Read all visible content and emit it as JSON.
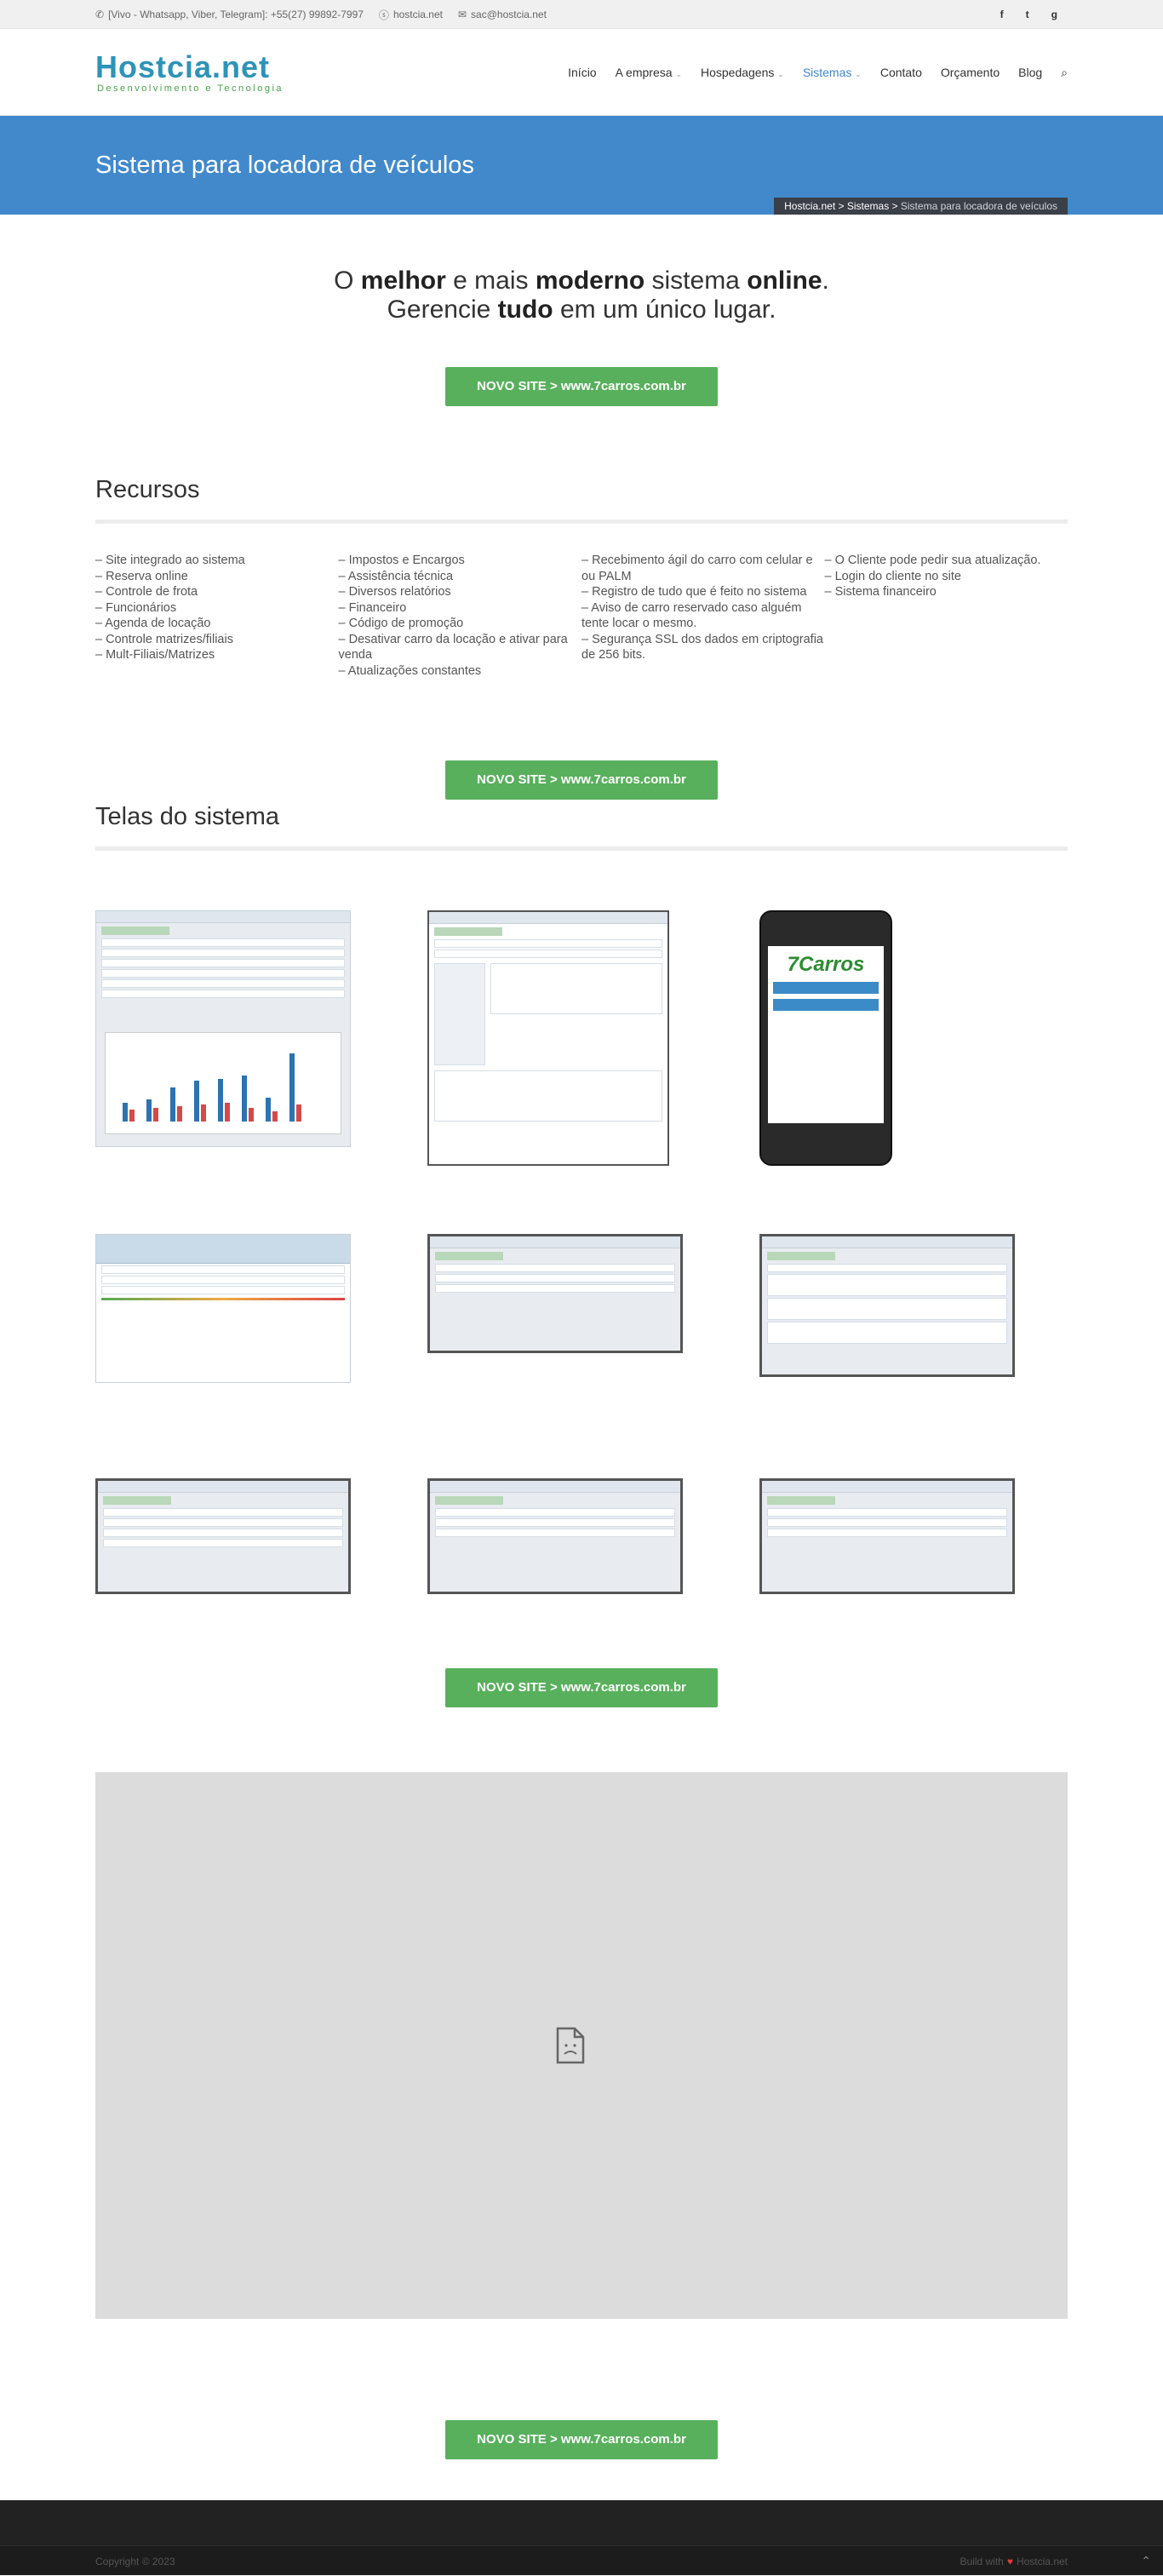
{
  "topbar": {
    "phone": "[Vivo - Whatsapp, Viber, Telegram]: +55(27) 99892-7997",
    "skype": "hostcia.net",
    "email": "sac@hostcia.net"
  },
  "logo": {
    "name": "Hostcia.net",
    "tagline": "Desenvolvimento e Tecnologia"
  },
  "nav": {
    "items": [
      "Início",
      "A empresa",
      "Hospedagens",
      "Sistemas",
      "Contato",
      "Orçamento",
      "Blog"
    ],
    "active": "Sistemas"
  },
  "banner": {
    "title": "Sistema para locadora de veículos",
    "crumb_home": "Hostcia.net",
    "crumb_sep1": " > ",
    "crumb_section": "Sistemas",
    "crumb_sep2": " > ",
    "crumb_current": "Sistema para locadora de veículos"
  },
  "hero": {
    "l1a": "O ",
    "l1b": "melhor",
    "l1c": " e mais ",
    "l1d": "moderno",
    "l1e": " sistema ",
    "l1f": "online",
    "l1g": ".",
    "l2a": "Gerencie ",
    "l2b": "tudo",
    "l2c": " em um único lugar."
  },
  "cta": "NOVO SITE > www.7carros.com.br",
  "recursos": {
    "title": "Recursos",
    "col1": [
      "– Site integrado ao sistema",
      "– Reserva online",
      "– Controle de frota",
      "– Funcionários",
      "– Agenda de locação",
      "– Controle matrizes/filiais",
      "– Mult-Filiais/Matrizes"
    ],
    "col2": [
      "– Impostos e Encargos",
      "– Assistência técnica",
      "– Diversos relatórios",
      "– Financeiro",
      "– Código de promoção",
      "– Desativar carro da locação e ativar para venda",
      "– Atualizações constantes"
    ],
    "col3": [
      "– Recebimento ágil do carro com celular e ou PALM",
      "– Registro de tudo que é feito no sistema",
      "– Aviso de carro reservado caso alguém tente locar o mesmo.",
      "– Segurança SSL dos dados em criptografia de 256 bits."
    ],
    "col4": [
      "– O Cliente pode pedir sua atualização.",
      "– Login do cliente no site",
      "– Sistema financeiro"
    ]
  },
  "telas": {
    "title": "Telas do sistema",
    "phone_logo": "7Carros"
  },
  "footer": {
    "copyright": "Copyright © 2023",
    "build": "Build with",
    "brand": "Hostcia.net"
  }
}
